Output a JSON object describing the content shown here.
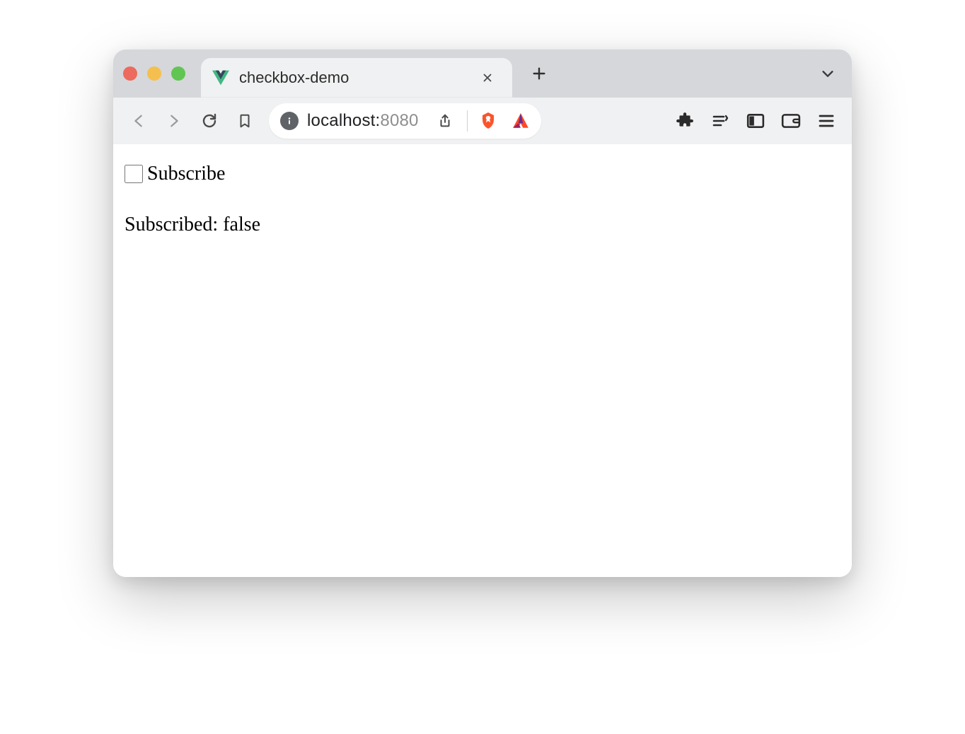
{
  "browser": {
    "tab": {
      "title": "checkbox-demo",
      "favicon": "vue-logo"
    },
    "address": {
      "host": "localhost:",
      "port": "8080"
    }
  },
  "page": {
    "checkbox_label": "Subscribe",
    "checkbox_checked": false,
    "status_prefix": "Subscribed: ",
    "status_value": "false"
  }
}
